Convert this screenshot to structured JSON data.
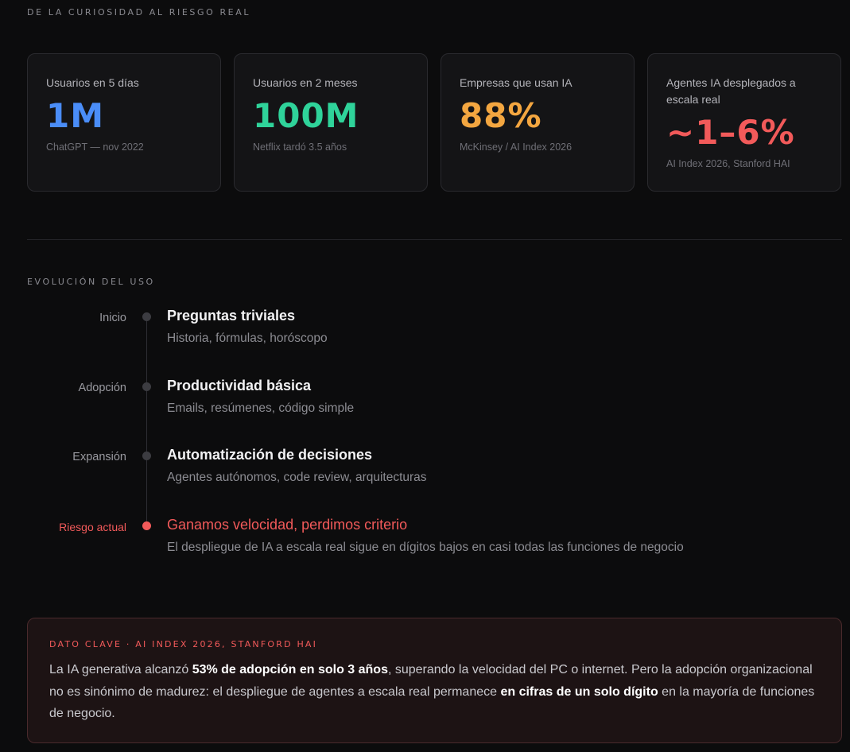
{
  "header": {
    "label": "DE LA CURIOSIDAD AL RIESGO REAL"
  },
  "stats": [
    {
      "label": "Usuarios en 5 días",
      "value": "1M",
      "source": "ChatGPT — nov 2022",
      "color": "#4a8df8"
    },
    {
      "label": "Usuarios en 2 meses",
      "value": "100M",
      "source": "Netflix tardó 3.5 años",
      "color": "#2fd39a"
    },
    {
      "label": "Empresas que usan IA",
      "value": "88%",
      "source": "McKinsey / AI Index 2026",
      "color": "#f3a640"
    },
    {
      "label": "Agentes IA desplegados a escala real",
      "value": "~1–6%",
      "source": "AI Index 2026, Stanford HAI",
      "color": "#f25a5a"
    }
  ],
  "timeline": {
    "label": "EVOLUCIÓN DEL USO",
    "items": [
      {
        "phase": "Inicio",
        "title": "Preguntas triviales",
        "desc": "Historia, fórmulas, horóscopo"
      },
      {
        "phase": "Adopción",
        "title": "Productividad básica",
        "desc": "Emails, resúmenes, código simple"
      },
      {
        "phase": "Expansión",
        "title": "Automatización de decisiones",
        "desc": "Agentes autónomos, code review, arquitecturas"
      },
      {
        "phase": "Riesgo actual",
        "title": "Ganamos velocidad, perdimos criterio",
        "desc": "El despliegue de IA a escala real sigue en dígitos bajos en casi todas las funciones de negocio"
      }
    ]
  },
  "callout": {
    "label": "DATO CLAVE · AI INDEX 2026, STANFORD HAI",
    "text_1": "La IA generativa alcanzó ",
    "strong_1": "53% de adopción en solo 3 años",
    "text_2": ", superando la velocidad del PC o internet. Pero la adopción organizacional no es sinónimo de madurez: el despliegue de agentes a escala real permanece ",
    "strong_2": "en cifras de un solo dígito",
    "text_3": " en la mayoría de funciones de negocio."
  },
  "colors": {
    "accent_risk": "#f25a5a",
    "background": "#0c0c0d",
    "card": "#141416"
  }
}
